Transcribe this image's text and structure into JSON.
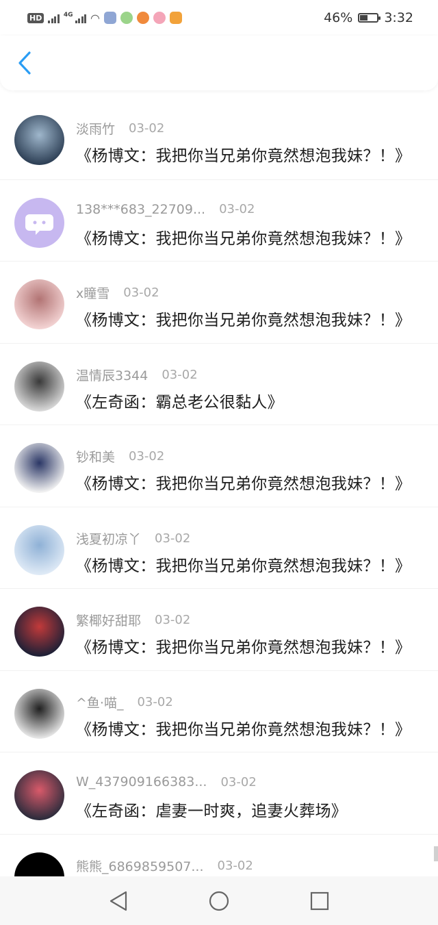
{
  "status_bar": {
    "hd": "HD",
    "network": "4G",
    "battery": "46%",
    "battery_level": 0.46,
    "time": "3:32"
  },
  "header": {
    "back_icon": "chevron-left-icon",
    "accent_color": "#2a9df4"
  },
  "comments": [
    {
      "name": "淡雨竹",
      "date": "03-02",
      "text": "《杨博文：我把你当兄弟你竟然想泡我妹？！》",
      "avatar_colors": [
        "#2d3f55",
        "#9fb7cc"
      ]
    },
    {
      "name": "138***683_22709...",
      "date": "03-02",
      "text": "《杨博文：我把你当兄弟你竟然想泡我妹？！》",
      "avatar_colors": [
        "#c7b8f0",
        "#ffffff"
      ]
    },
    {
      "name": "x瞳雪",
      "date": "03-02",
      "text": "《杨博文：我把你当兄弟你竟然想泡我妹？！》",
      "avatar_colors": [
        "#f3d3d3",
        "#b27474"
      ]
    },
    {
      "name": "温情辰3344",
      "date": "03-02",
      "text": "《左奇函：霸总老公很黏人》",
      "avatar_colors": [
        "#d8d8d8",
        "#3a3a3a"
      ]
    },
    {
      "name": "钞和美",
      "date": "03-02",
      "text": "《杨博文：我把你当兄弟你竟然想泡我妹？！》",
      "avatar_colors": [
        "#f2f2f2",
        "#2b3766"
      ]
    },
    {
      "name": "浅夏初凉丫",
      "date": "03-02",
      "text": "《杨博文：我把你当兄弟你竟然想泡我妹？！》",
      "avatar_colors": [
        "#dfeaf6",
        "#8fb1d6"
      ]
    },
    {
      "name": "繁椰好甜耶",
      "date": "03-02",
      "text": "《杨博文：我把你当兄弟你竟然想泡我妹？！》",
      "avatar_colors": [
        "#1d2036",
        "#c23a3a"
      ]
    },
    {
      "name": "^鱼·喵_",
      "date": "03-02",
      "text": "《杨博文：我把你当兄弟你竟然想泡我妹？！》",
      "avatar_colors": [
        "#e6e6e6",
        "#202020"
      ]
    },
    {
      "name": "W_437909166383...",
      "date": "03-02",
      "text": "《左奇函：虐妻一时爽，追妻火葬场》",
      "avatar_colors": [
        "#2c2c3c",
        "#d95a6a"
      ]
    },
    {
      "name": "熊熊_6869859507...",
      "date": "03-02",
      "text": "",
      "avatar_colors": [
        "#000000",
        "#000000"
      ]
    }
  ],
  "nav": {
    "back_icon": "triangle-back-icon",
    "home_icon": "circle-home-icon",
    "recents_icon": "square-recents-icon"
  }
}
